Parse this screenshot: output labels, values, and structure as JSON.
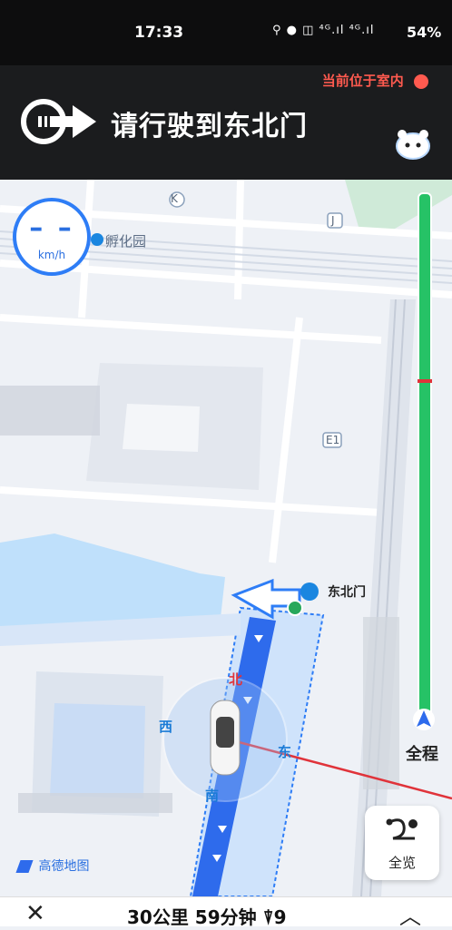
{
  "status_bar": {
    "time": "17:33",
    "icons": "⚲ ● ◫ ⁴ᴳ.ıl ⁴ᴳ.ıl",
    "battery": "54%"
  },
  "nav": {
    "indoor_notice": "当前位于室内",
    "instruction": "请行驶到东北门"
  },
  "speed": {
    "value": "– –",
    "unit": "km/h"
  },
  "map": {
    "poi_incubator": "孵化园",
    "marker_k": "K",
    "marker_j": "J",
    "marker_e1": "E1",
    "destination": "东北门",
    "compass": {
      "north": "北",
      "south": "南",
      "east": "东",
      "west": "西"
    },
    "logo": "高德地图"
  },
  "side": {
    "full_route": "全程",
    "overview": "全览"
  },
  "bottom_bar": {
    "summary": "30公里 59分钟 ⍒9"
  },
  "colors": {
    "route": "#2e6bec",
    "progress": "#26c266",
    "accent": "#ff5a4f"
  }
}
